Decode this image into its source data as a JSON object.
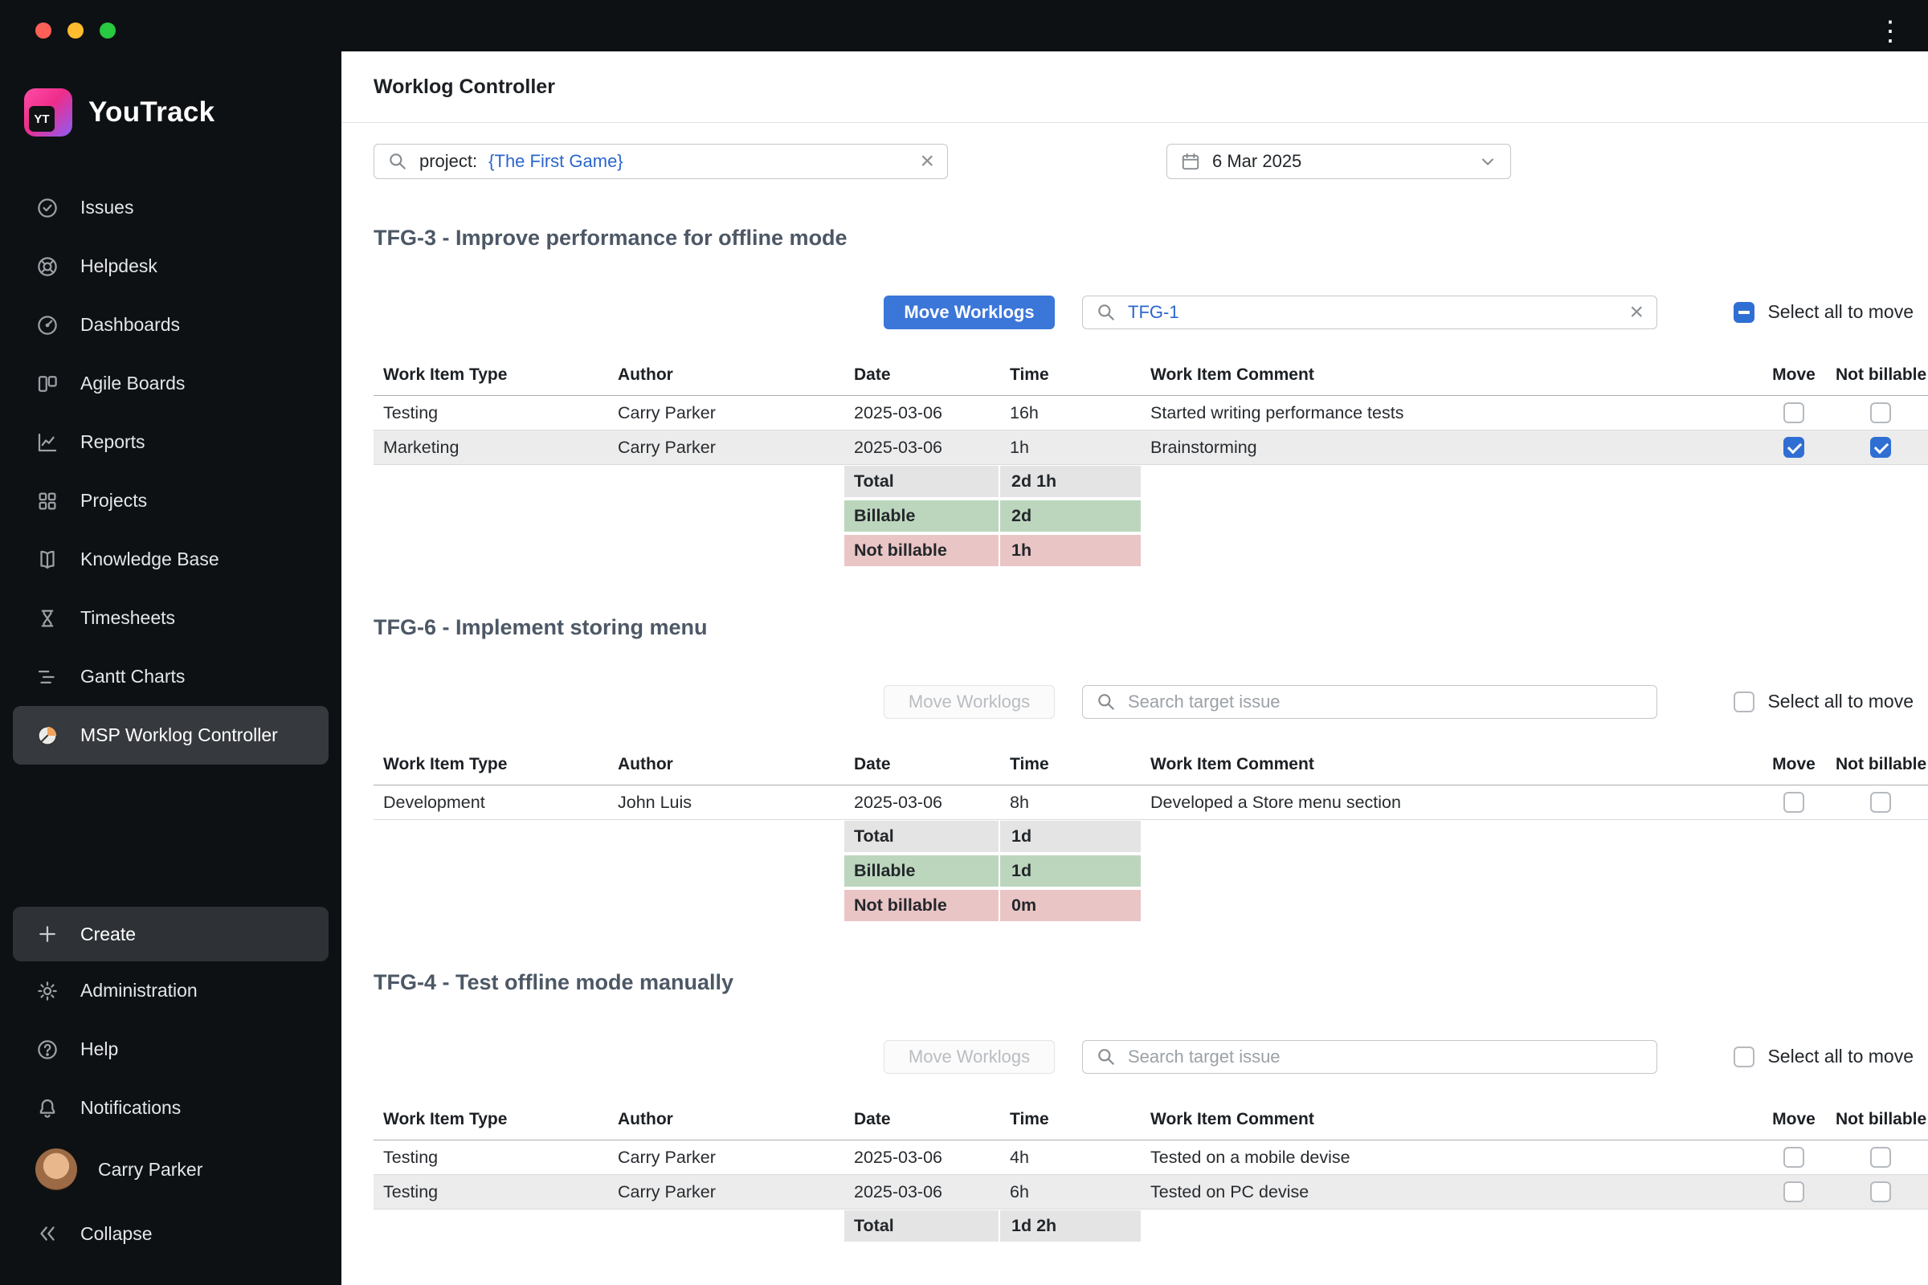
{
  "titlebar": {
    "kebab_icon": "⋮"
  },
  "sidebar": {
    "brand": {
      "badge": "YT",
      "name": "YouTrack"
    },
    "items": [
      {
        "label": "Issues"
      },
      {
        "label": "Helpdesk"
      },
      {
        "label": "Dashboards"
      },
      {
        "label": "Agile Boards"
      },
      {
        "label": "Reports"
      },
      {
        "label": "Projects"
      },
      {
        "label": "Knowledge Base"
      },
      {
        "label": "Timesheets"
      },
      {
        "label": "Gantt Charts"
      },
      {
        "label": "MSP Worklog Controller"
      }
    ],
    "footer_items": [
      {
        "label": "Create"
      },
      {
        "label": "Administration"
      },
      {
        "label": "Help"
      },
      {
        "label": "Notifications"
      },
      {
        "label": "Carry Parker"
      },
      {
        "label": "Collapse"
      }
    ]
  },
  "header": {
    "title": "Worklog Controller"
  },
  "filters": {
    "project_search": {
      "prefix": "project: ",
      "value": "{The First Game}"
    },
    "date_picker": {
      "value": "6 Mar 2025"
    }
  },
  "labels": {
    "move_worklogs": "Move Worklogs",
    "select_all": "Select all to move",
    "target_placeholder": "Search target issue",
    "total": "Total",
    "billable": "Billable",
    "not_billable": "Not billable"
  },
  "table_headers": [
    "Work Item Type",
    "Author",
    "Date",
    "Time",
    "Work Item Comment",
    "Move",
    "Not billable"
  ],
  "sections": [
    {
      "title": "TFG-3 - Improve performance for offline mode",
      "move_enabled": true,
      "target_value": "TFG-1",
      "select_all_state": "indeterminate",
      "rows": [
        {
          "type": "Testing",
          "author": "Carry Parker",
          "date": "2025-03-06",
          "time": "16h",
          "comment": "Started writing performance tests",
          "move": false,
          "not_billable": false
        },
        {
          "type": "Marketing",
          "author": "Carry Parker",
          "date": "2025-03-06",
          "time": "1h",
          "comment": "Brainstorming",
          "move": true,
          "not_billable": true
        }
      ],
      "summary": {
        "total": "2d 1h",
        "billable": "2d",
        "not_billable": "1h"
      }
    },
    {
      "title": "TFG-6 - Implement storing menu",
      "move_enabled": false,
      "target_value": "",
      "select_all_state": "unchecked",
      "rows": [
        {
          "type": "Development",
          "author": "John Luis",
          "date": "2025-03-06",
          "time": "8h",
          "comment": "Developed a Store menu section",
          "move": false,
          "not_billable": false
        }
      ],
      "summary": {
        "total": "1d",
        "billable": "1d",
        "not_billable": "0m"
      }
    },
    {
      "title": "TFG-4 - Test offline mode manually",
      "move_enabled": false,
      "target_value": "",
      "select_all_state": "unchecked",
      "rows": [
        {
          "type": "Testing",
          "author": "Carry Parker",
          "date": "2025-03-06",
          "time": "4h",
          "comment": "Tested on a mobile devise",
          "move": false,
          "not_billable": false
        },
        {
          "type": "Testing",
          "author": "Carry Parker",
          "date": "2025-03-06",
          "time": "6h",
          "comment": "Tested on PC devise",
          "move": false,
          "not_billable": false
        }
      ],
      "summary": {
        "total": "1d 2h"
      }
    }
  ]
}
